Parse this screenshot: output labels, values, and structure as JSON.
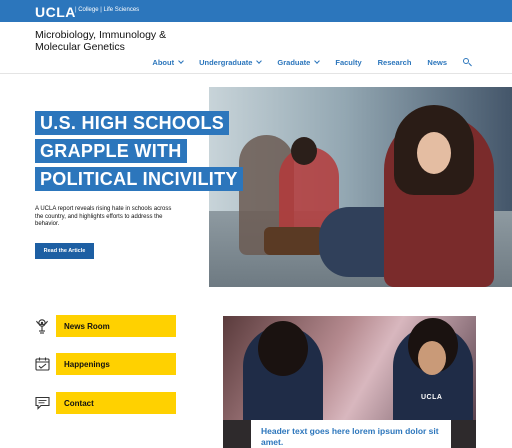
{
  "brand": {
    "logo": "UCLA",
    "tagline": "| College | Life Sciences"
  },
  "site": {
    "title": "Microbiology, Immunology & Molecular Genetics"
  },
  "nav": {
    "items": [
      {
        "label": "About",
        "dropdown": true
      },
      {
        "label": "Undergraduate",
        "dropdown": true
      },
      {
        "label": "Graduate",
        "dropdown": true
      },
      {
        "label": "Faculty",
        "dropdown": false
      },
      {
        "label": "Research",
        "dropdown": false
      },
      {
        "label": "News",
        "dropdown": false
      }
    ],
    "search_icon": "search-icon"
  },
  "hero": {
    "headline_lines": [
      "U.S. HIGH SCHOOLS",
      "GRAPPLE WITH",
      "POLITICAL INCIVILITY"
    ],
    "summary": "A UCLA report reveals rising hate in schools across the country, and highlights efforts to address the behavior.",
    "button_label": "Read the Article"
  },
  "quick_links": [
    {
      "label": "News Room",
      "icon": "microphone-icon"
    },
    {
      "label": "Happenings",
      "icon": "calendar-icon"
    },
    {
      "label": "Contact",
      "icon": "chat-icon"
    }
  ],
  "story": {
    "header_text": "Header text goes here lorem ipsum dolor sit amet.",
    "shirt_text": "UCLA"
  },
  "colors": {
    "ucla_blue": "#2c76bc",
    "button_blue": "#1d5fa3",
    "ucla_gold": "#ffd100"
  }
}
